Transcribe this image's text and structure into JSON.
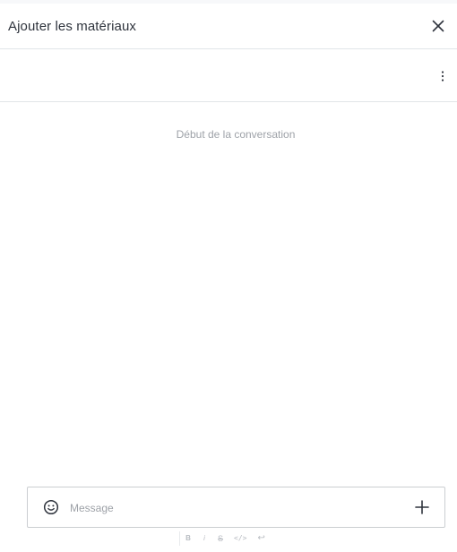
{
  "header": {
    "title": "Ajouter les matériaux",
    "close_icon": "close-icon"
  },
  "toolbar": {
    "kebab_icon": "kebab-menu-icon"
  },
  "messages": {
    "conversation_start": "Début de la conversation"
  },
  "composer": {
    "placeholder": "Message",
    "value": "",
    "emoji_icon": "emoji-icon",
    "add_icon": "plus-icon"
  },
  "formatting": {
    "bold": "B",
    "italic": "i",
    "strike": "S",
    "code": "</>",
    "return": "↩"
  },
  "colors": {
    "text": "#2f343d",
    "muted": "#9ea2a8",
    "border": "#e1e5e8"
  }
}
